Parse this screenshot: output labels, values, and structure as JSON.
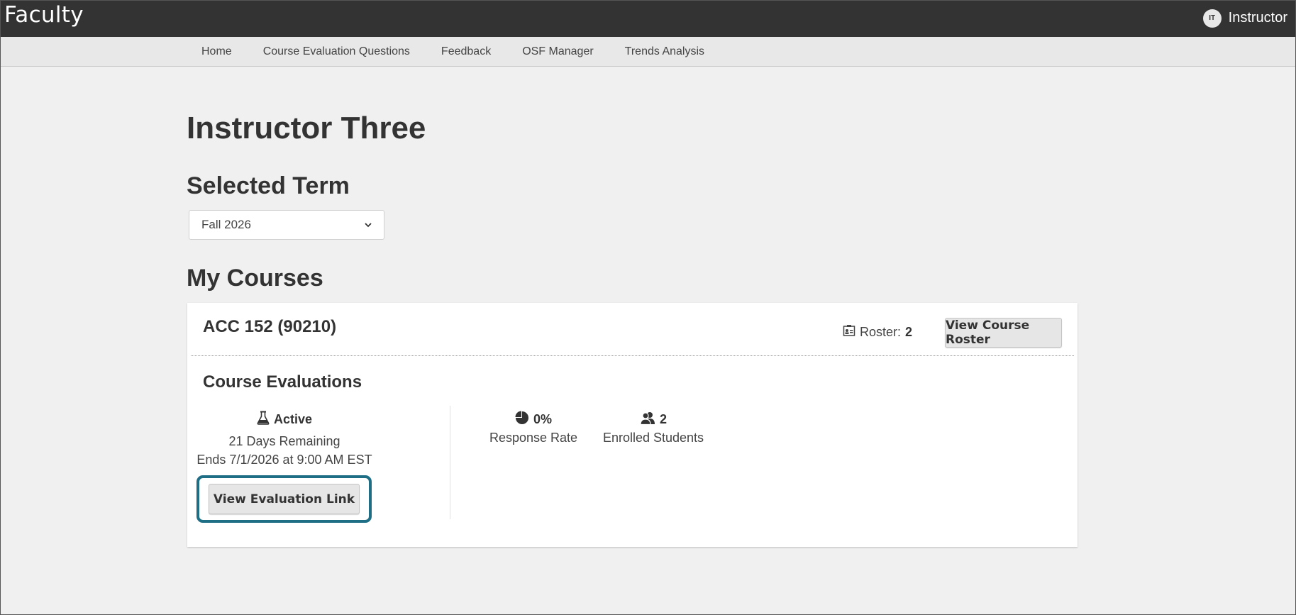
{
  "header": {
    "brand": "Faculty",
    "user_initials": "IT",
    "user_role": "Instructor"
  },
  "nav": {
    "items": [
      "Home",
      "Course Evaluation Questions",
      "Feedback",
      "OSF Manager",
      "Trends Analysis"
    ]
  },
  "page": {
    "instructor_name": "Instructor Three",
    "term_heading": "Selected Term",
    "term_selected": "Fall 2026",
    "courses_heading": "My Courses"
  },
  "course": {
    "title": "ACC 152 (90210)",
    "roster_label": "Roster:",
    "roster_count": "2",
    "view_roster_button": "View Course Roster",
    "evaluations_heading": "Course Evaluations",
    "status": "Active",
    "days_remaining": "21 Days Remaining",
    "ends": "Ends 7/1/2026 at 9:00 AM EST",
    "view_link_button": "View Evaluation Link",
    "response_rate_value": "0%",
    "response_rate_label": "Response Rate",
    "enrolled_value": "2",
    "enrolled_label": "Enrolled Students"
  },
  "icons": {
    "roster": "roster-card-icon",
    "status": "flask-icon",
    "response_rate": "pie-chart-icon",
    "enrolled": "users-icon"
  },
  "colors": {
    "topbar": "#333333",
    "focus_ring": "#1e6f86"
  }
}
